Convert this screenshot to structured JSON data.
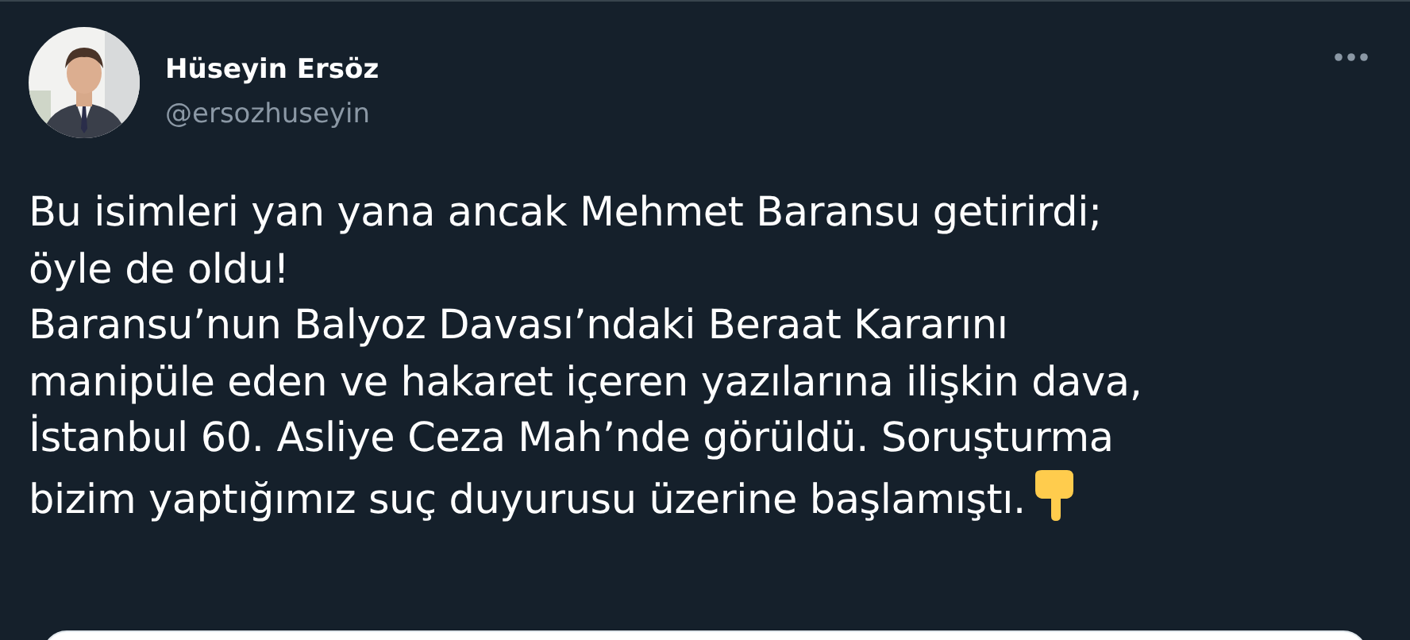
{
  "author": {
    "name": "Hüseyin Ersöz",
    "handle": "@ersozhuseyin"
  },
  "tweet": {
    "lines": [
      "Bu isimleri yan yana ancak Mehmet Baransu getirirdi;",
      "öyle de oldu!",
      "Baransu’nun Balyoz Davası’ndaki Beraat Kararını",
      "manipüle eden ve hakaret içeren yazılarına ilişkin dava,",
      "İstanbul 60. Asliye Ceza Mah’nde görüldü. Soruşturma",
      "bizim yaptığımız suç duyurusu üzerine başlamıştı."
    ]
  }
}
